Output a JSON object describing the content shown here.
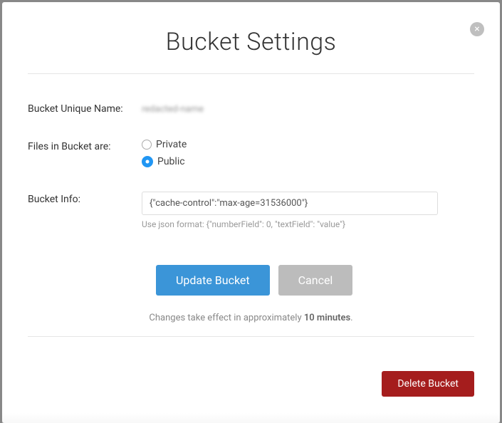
{
  "modal": {
    "title": "Bucket Settings",
    "close_label": "×"
  },
  "form": {
    "name_label": "Bucket Unique Name:",
    "name_value": "redacted-name",
    "files_label": "Files in Bucket are:",
    "privacy": {
      "private_label": "Private",
      "public_label": "Public",
      "selected": "public"
    },
    "info_label": "Bucket Info:",
    "info_value": "{\"cache-control\":\"max-age=31536000\"}",
    "info_hint": "Use json format: {\"numberField\": 0, \"textField\": \"value\"}"
  },
  "actions": {
    "update_label": "Update Bucket",
    "cancel_label": "Cancel",
    "notice_prefix": "Changes take effect in approximately ",
    "notice_bold": "10 minutes",
    "notice_suffix": ".",
    "delete_label": "Delete Bucket"
  }
}
